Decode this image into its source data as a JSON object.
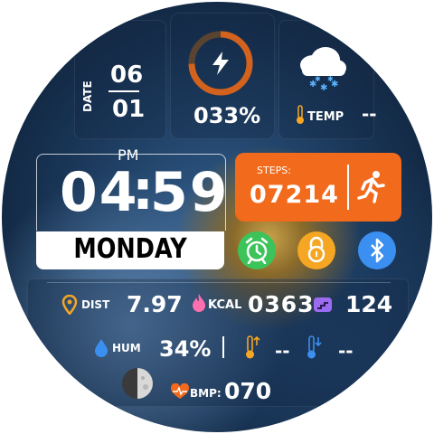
{
  "date": {
    "label": "DATE",
    "month": "06",
    "day": "01"
  },
  "battery": {
    "percent_text": "033%",
    "level": 0.33,
    "ring_color": "#e8671a"
  },
  "weather": {
    "temp_label": "TEMP",
    "temp_value": "--"
  },
  "time": {
    "ampm": "PM",
    "hours": "04",
    "minutes": "59",
    "weekday": "MONDAY"
  },
  "steps": {
    "label": "STEPS:",
    "value": "07214",
    "color": "#f26a1b"
  },
  "shortcuts": {
    "alarm_color": "#3cc35a",
    "lock_color": "#f5a623",
    "bluetooth_color": "#3b8ff0"
  },
  "stats": {
    "dist_label": "DIST",
    "dist_value": "7.97",
    "kcal_label": "KCAL",
    "kcal_value": "0363",
    "floors_value": "124",
    "hum_label": "HUM",
    "hum_value": "34%",
    "temp_high_value": "--",
    "temp_low_value": "--",
    "bpm_label": "BMP:",
    "bpm_value": "070"
  },
  "colors": {
    "dist_icon": "#f5a623",
    "kcal_icon": "#ff6fae",
    "floors_icon": "#9b6cf0",
    "hum_icon": "#3b8ff0",
    "bpm_icon": "#f26a1b"
  }
}
